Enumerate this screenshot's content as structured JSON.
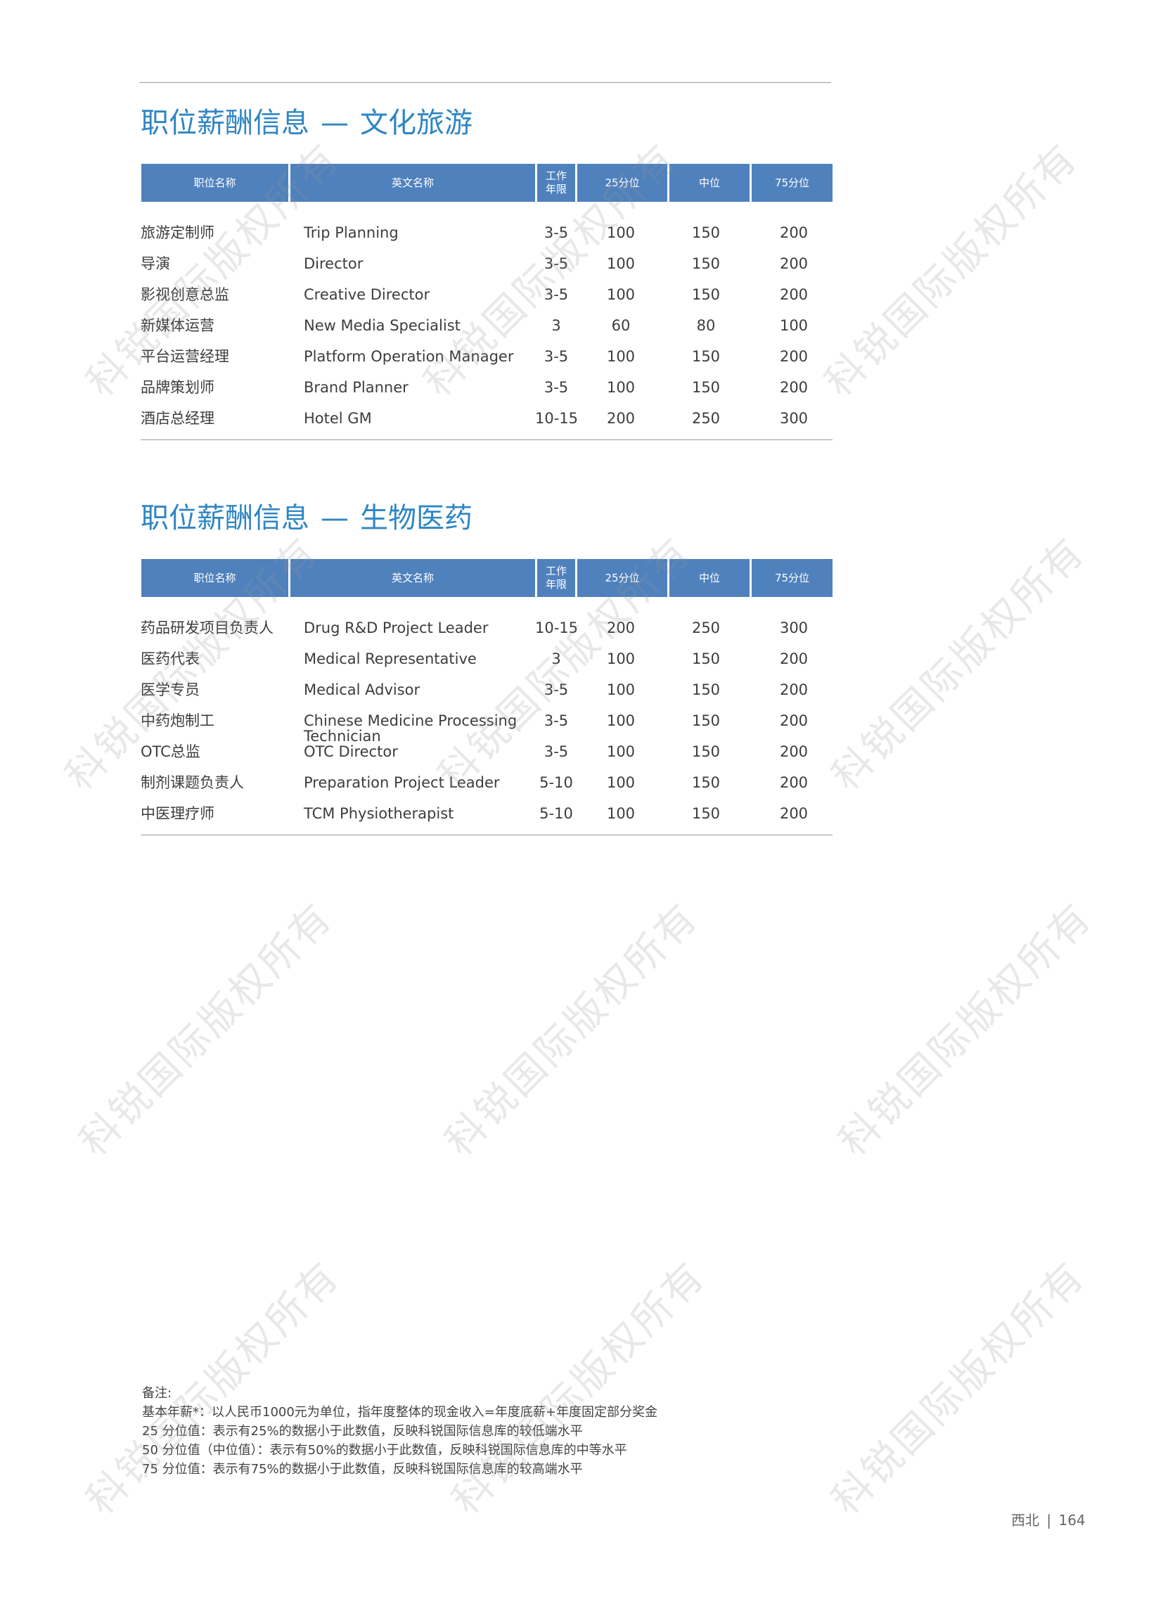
{
  "sections": [
    {
      "title_main": "职位薪酬信息",
      "title_dash": "—",
      "title_sub": "文化旅游",
      "headers": {
        "cn_name": "职位名称",
        "en_name": "英文名称",
        "years_line1": "工作",
        "years_line2": "年限",
        "p25": "25分位",
        "median": "中位",
        "p75": "75分位"
      },
      "rows": [
        {
          "cn": "旅游定制师",
          "en": "Trip Planning",
          "years": "3-5",
          "p25": "100",
          "median": "150",
          "p75": "200"
        },
        {
          "cn": "导演",
          "en": "Director",
          "years": "3-5",
          "p25": "100",
          "median": "150",
          "p75": "200"
        },
        {
          "cn": "影视创意总监",
          "en": "Creative Director",
          "years": "3-5",
          "p25": "100",
          "median": "150",
          "p75": "200"
        },
        {
          "cn": "新媒体运营",
          "en": "New Media Specialist",
          "years": "3",
          "p25": "60",
          "median": "80",
          "p75": "100"
        },
        {
          "cn": "平台运营经理",
          "en": "Platform Operation Manager",
          "years": "3-5",
          "p25": "100",
          "median": "150",
          "p75": "200"
        },
        {
          "cn": "品牌策划师",
          "en": "Brand Planner",
          "years": "3-5",
          "p25": "100",
          "median": "150",
          "p75": "200"
        },
        {
          "cn": "酒店总经理",
          "en": "Hotel GM",
          "years": "10-15",
          "p25": "200",
          "median": "250",
          "p75": "300"
        }
      ]
    },
    {
      "title_main": "职位薪酬信息",
      "title_dash": "—",
      "title_sub": "生物医药",
      "headers": {
        "cn_name": "职位名称",
        "en_name": "英文名称",
        "years_line1": "工作",
        "years_line2": "年限",
        "p25": "25分位",
        "median": "中位",
        "p75": "75分位"
      },
      "rows": [
        {
          "cn": "药品研发项目负责人",
          "en": "Drug R&D Project Leader",
          "years": "10-15",
          "p25": "200",
          "median": "250",
          "p75": "300"
        },
        {
          "cn": "医药代表",
          "en": "Medical Representative",
          "years": "3",
          "p25": "100",
          "median": "150",
          "p75": "200"
        },
        {
          "cn": "医学专员",
          "en": "Medical Advisor",
          "years": "3-5",
          "p25": "100",
          "median": "150",
          "p75": "200"
        },
        {
          "cn": "中药炮制工",
          "en": "Chinese Medicine Processing Technician",
          "years": "3-5",
          "p25": "100",
          "median": "150",
          "p75": "200"
        },
        {
          "cn": "OTC总监",
          "en": "OTC Director",
          "years": "3-5",
          "p25": "100",
          "median": "150",
          "p75": "200"
        },
        {
          "cn": "制剂课题负责人",
          "en": "Preparation Project Leader",
          "years": "5-10",
          "p25": "100",
          "median": "150",
          "p75": "200"
        },
        {
          "cn": "中医理疗师",
          "en": "TCM Physiotherapist",
          "years": "5-10",
          "p25": "100",
          "median": "150",
          "p75": "200"
        }
      ]
    }
  ],
  "notes": {
    "heading": "备注:",
    "lines": [
      "基本年薪*：以人民币1000元为单位，指年度整体的现金收入=年度底薪+年度固定部分奖金",
      "25 分位值：表示有25%的数据小于此数值，反映科锐国际信息库的较低端水平",
      "50 分位值（中位值）：表示有50%的数据小于此数值，反映科锐国际信息库的中等水平",
      "75 分位值：表示有75%的数据小于此数值，反映科锐国际信息库的较高端水平"
    ]
  },
  "footer": {
    "region": "西北",
    "separator": "|",
    "page_number": "164"
  },
  "watermark_text": "科锐国际版权所有",
  "colors": {
    "title_blue": "#2f86c3",
    "header_blue": "#4f81bd",
    "rule_gray": "#9a9a9a"
  }
}
